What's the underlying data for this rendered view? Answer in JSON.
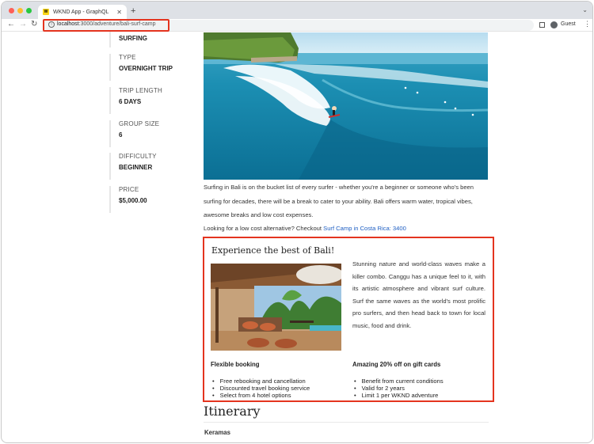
{
  "browser": {
    "tab_title": "WKND App - GraphQL",
    "favicon_text": "W",
    "url_host": "localhost",
    "url_rest": ":3000/adventure/bali-surf-camp",
    "profile_label": "Guest"
  },
  "sidebar": {
    "activity_value": "SURFING",
    "items": [
      {
        "label": "TYPE",
        "value": "OVERNIGHT TRIP"
      },
      {
        "label": "TRIP LENGTH",
        "value": "6 DAYS"
      },
      {
        "label": "GROUP SIZE",
        "value": "6"
      },
      {
        "label": "DIFFICULTY",
        "value": "BEGINNER"
      },
      {
        "label": "PRICE",
        "value": "$5,000.00"
      }
    ]
  },
  "main": {
    "description": "Surfing in Bali is on the bucket list of every surfer - whether you're a beginner or someone who's been surfing for decades, there will be a break to cater to your ability. Bali offers warm water, tropical vibes, awesome breaks and low cost expenses.",
    "alt_prefix": "Looking for a low cost alternative? Checkout ",
    "alt_link": "Surf Camp in Costa Rica: 3400"
  },
  "promo": {
    "title": "Experience the best of Bali!",
    "text": "Stunning nature and world-class waves make a killer combo. Canggu has a unique feel to it, with its artistic atmosphere and vibrant surf culture. Surf the same waves as the world's most prolific pro surfers, and then head back to town for local music, food and drink.",
    "col1_heading": "Flexible booking",
    "col1_items": [
      "Free rebooking and cancellation",
      "Discounted travel booking service",
      "Select from 4 hotel options"
    ],
    "col2_heading": "Amazing 20% off on gift cards",
    "col2_items": [
      "Benefit from current conditions",
      "Valid for 2 years",
      "Limit 1 per WKND adventure"
    ]
  },
  "itinerary": {
    "heading": "Itinerary",
    "first_day": "Keramas"
  }
}
